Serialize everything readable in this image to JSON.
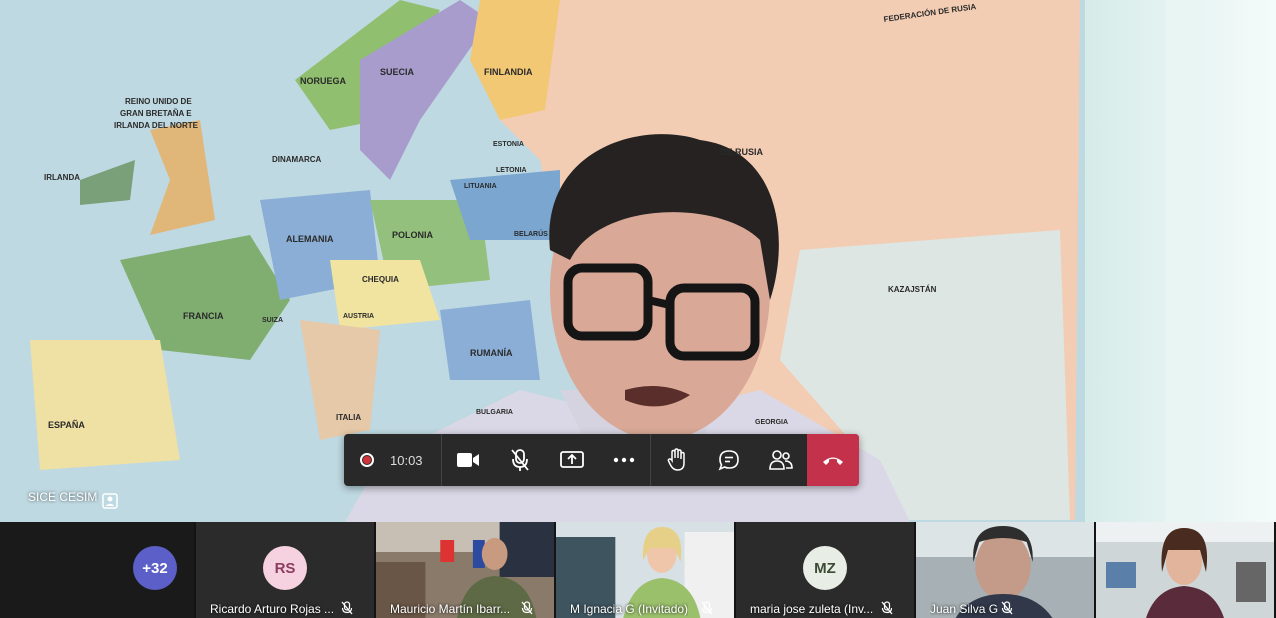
{
  "main": {
    "speaker_name": "SICE CESIM",
    "map_labels": [
      "NORUEGA",
      "SUECIA",
      "FINLANDIA",
      "REINO UNIDO DE GRAN BRETAÑA E IRLANDA DEL NORTE",
      "IRLANDA",
      "DINAMARCA",
      "ESTONIA",
      "LETONIA",
      "LITUANIA",
      "BELARÚS",
      "ALEMANIA",
      "POLONIA",
      "FRANCIA",
      "CHEQUIA",
      "AUSTRIA",
      "SUIZA",
      "RUMANÍA",
      "ESPAÑA",
      "ITALIA",
      "BULGARIA",
      "FEDERACIÓN DE RUSIA",
      "DE RUSIA",
      "KAZAJSTÁN",
      "GEORGIA"
    ]
  },
  "toolbar": {
    "timer": "10:03",
    "icons": [
      "record-indicator-icon",
      "camera-icon",
      "mic-off-icon",
      "share-screen-icon",
      "more-icon",
      "raise-hand-icon",
      "chat-icon",
      "participants-icon",
      "hang-up-icon"
    ]
  },
  "participants": {
    "overflow_count": "+32",
    "tiles": [
      {
        "initials": "RS",
        "name": "Ricardo Arturo Rojas ...",
        "avatar_color": "#f6d2e0",
        "initials_color": "#8b3d5e"
      },
      {
        "name": "Mauricio Martín Ibarr..."
      },
      {
        "name": "M Ignacia G (Invitado)"
      },
      {
        "initials": "MZ",
        "name": "maria jose zuleta (Inv...",
        "avatar_color": "#e8ede6",
        "initials_color": "#3a4a33"
      },
      {
        "name": "Juan Silva G"
      },
      {
        "name": ""
      }
    ]
  },
  "colors": {
    "overflow_avatar": "#5b5fc7",
    "hangup": "#c4314b",
    "toolbar_bg": "#292929"
  }
}
